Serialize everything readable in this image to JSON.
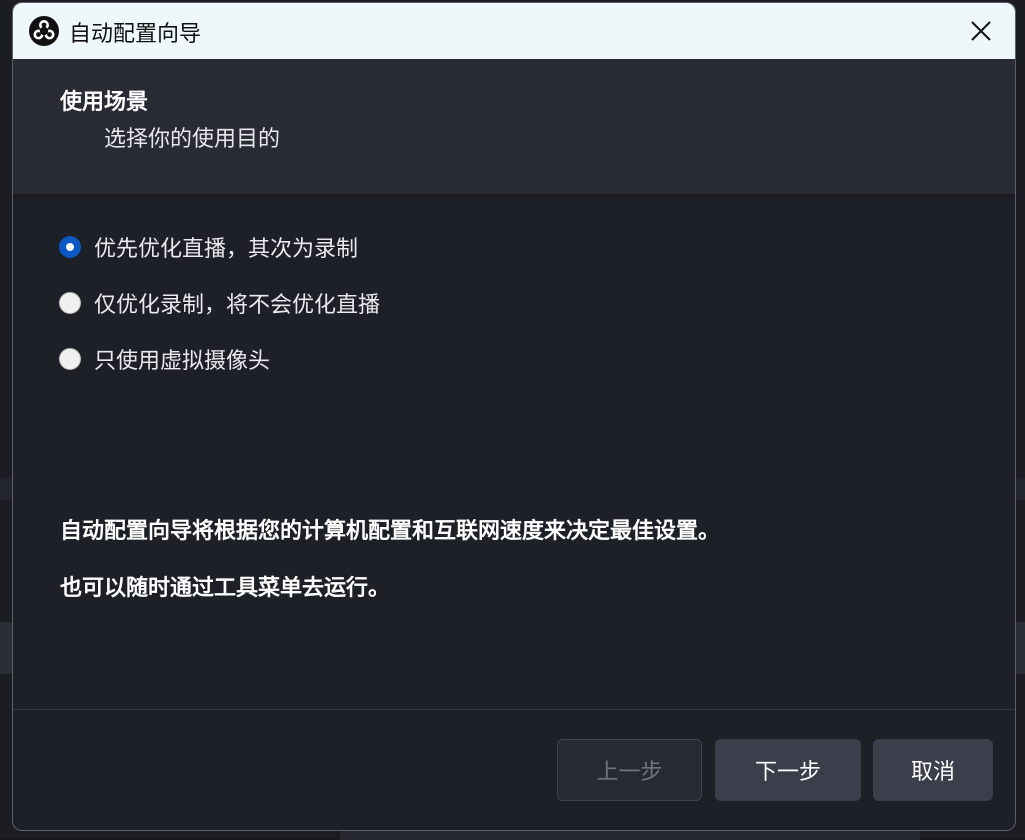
{
  "window": {
    "title": "自动配置向导",
    "app_icon": "obs-logo-icon",
    "close_icon": "close-icon"
  },
  "header": {
    "title": "使用场景",
    "subtitle": "选择你的使用目的"
  },
  "options": [
    {
      "label": "优先优化直播，其次为录制",
      "checked": true
    },
    {
      "label": "仅优化录制，将不会优化直播",
      "checked": false
    },
    {
      "label": "只使用虚拟摄像头",
      "checked": false
    }
  ],
  "info": {
    "line1": "自动配置向导将根据您的计算机配置和互联网速度来决定最佳设置。",
    "line2": "也可以随时通过工具菜单去运行。"
  },
  "buttons": {
    "back": "上一步",
    "next": "下一步",
    "cancel": "取消"
  },
  "colors": {
    "accent": "#0b57c4",
    "dialog_bg": "#1e2028",
    "header_bg": "#282b34",
    "titlebar_bg": "#eef8fa"
  }
}
